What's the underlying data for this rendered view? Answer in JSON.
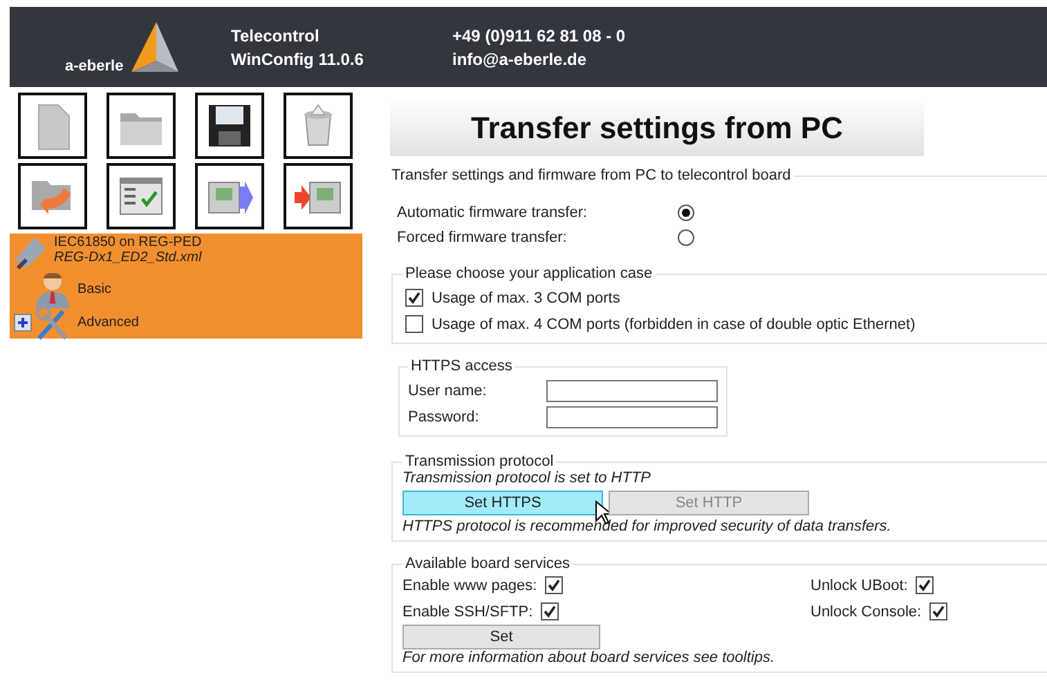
{
  "header": {
    "product": "Telecontrol",
    "version": "WinConfig 11.0.6",
    "phone": "+49 (0)911 62 81 08 - 0",
    "email": "info@a-eberle.de",
    "logo_text": "a-eberle"
  },
  "tree": {
    "title": "IEC61850 on REG-PED",
    "subtitle": "REG-Dx1_ED2_Std.xml",
    "selected": true,
    "children": [
      {
        "label": "Basic",
        "kind": "user"
      },
      {
        "label": "Advanced",
        "kind": "tools",
        "expanded": false
      }
    ]
  },
  "page_title": "Transfer settings from PC",
  "transfer": {
    "legend": "Transfer settings and firmware from PC to telecontrol board",
    "options": [
      {
        "label": "Automatic firmware transfer:",
        "selected": true
      },
      {
        "label": "Forced firmware transfer:",
        "selected": false
      }
    ]
  },
  "application_case": {
    "legend": "Please choose your application case",
    "options": [
      {
        "label": "Usage of max. 3 COM ports",
        "checked": true
      },
      {
        "label": "Usage of max. 4 COM ports (forbidden in case of double optic Ethernet)",
        "checked": false
      }
    ]
  },
  "https_access": {
    "legend": "HTTPS access",
    "fields": [
      {
        "label": "User name:"
      },
      {
        "label": "Password:"
      }
    ]
  },
  "transmission": {
    "legend": "Transmission protocol",
    "status": "Transmission protocol is set to HTTP",
    "buttons": [
      {
        "label": "Set HTTPS",
        "hovered": true,
        "disabled": false
      },
      {
        "label": "Set HTTP",
        "hovered": false,
        "disabled": true
      }
    ],
    "note": "HTTPS protocol is recommended for improved security of data transfers."
  },
  "board_services": {
    "legend": "Available board services",
    "options": [
      {
        "label": "Enable www pages:",
        "checked": true
      },
      {
        "label": "Unlock UBoot:",
        "checked": true
      },
      {
        "label": "Enable SSH/SFTP:",
        "checked": true
      },
      {
        "label": "Unlock Console:",
        "checked": true
      }
    ],
    "button": "Set",
    "note": "For more information about board services see tooltips."
  }
}
